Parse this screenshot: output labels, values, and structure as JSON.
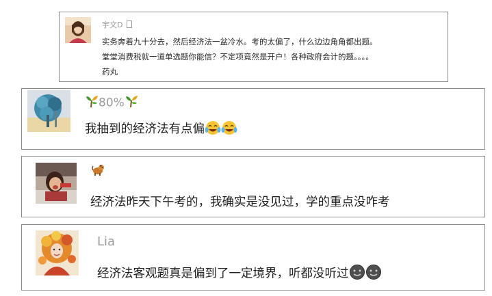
{
  "comments": [
    {
      "username": "宇文D",
      "badge_icon": "placeholder-box-icon",
      "lines": [
        "实务奔着九十分去，然后经济法一盆冷水。考的太偏了，什么边边角角都出题。",
        "堂堂消费税就一道单选题你能信？不定项竟然是开户！各种政府会计的题。。。。",
        "药丸"
      ]
    },
    {
      "username": "80%",
      "name_icon": "sprout-icon",
      "text": "我抽到的经济法有点偏",
      "trailing_icons": [
        "laugh-cry-emoji-icon",
        "laugh-cry-emoji-icon"
      ]
    },
    {
      "username": "",
      "name_icon": "dog-icon",
      "text": "经济法昨天下午考的，我确实是没见过，学的重点没咋考"
    },
    {
      "username": "Lia",
      "text": "经济法客观题真是偏到了一定境界，听都没听过",
      "trailing_icons": [
        "dark-face-emoji-icon",
        "dark-face-emoji-icon"
      ]
    }
  ]
}
